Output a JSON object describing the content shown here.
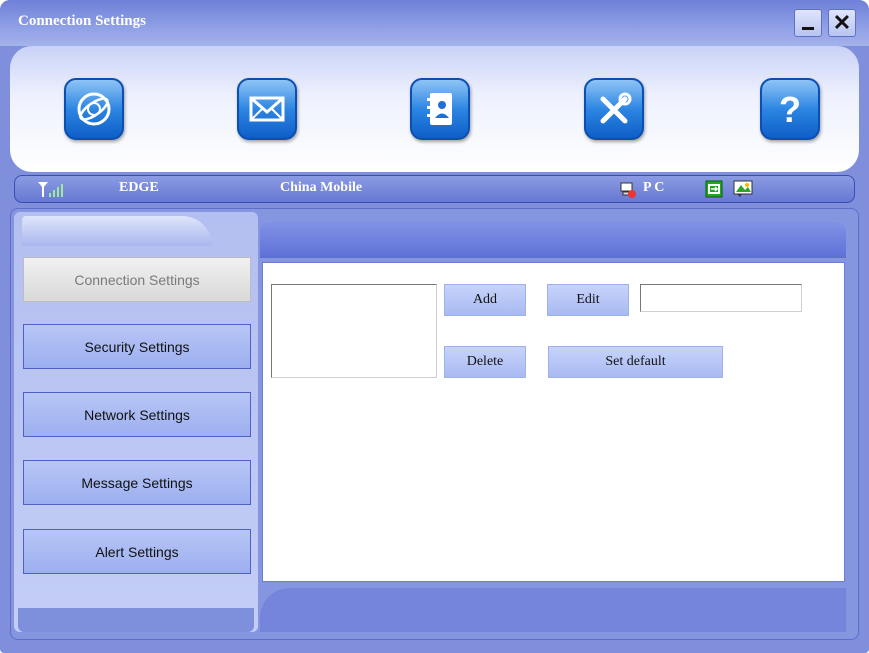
{
  "window": {
    "title": "Connection Settings"
  },
  "toolbar": {
    "buttons": [
      {
        "name": "internet-connect",
        "icon": "globe-icon"
      },
      {
        "name": "messages",
        "icon": "envelope-icon"
      },
      {
        "name": "phonebook",
        "icon": "contacts-book-icon"
      },
      {
        "name": "settings",
        "icon": "tools-icon"
      },
      {
        "name": "help",
        "icon": "question-mark-icon"
      }
    ]
  },
  "status": {
    "network_type": "EDGE",
    "operator": "China Mobile",
    "device_label": "P C"
  },
  "sidebar": {
    "items": [
      {
        "label": "Connection Settings",
        "active": true
      },
      {
        "label": "Security Settings",
        "active": false
      },
      {
        "label": "Network Settings",
        "active": false
      },
      {
        "label": "Message Settings",
        "active": false
      },
      {
        "label": "Alert Settings",
        "active": false
      }
    ]
  },
  "panel": {
    "add_label": "Add",
    "edit_label": "Edit",
    "delete_label": "Delete",
    "set_default_label": "Set default",
    "profile_name_value": ""
  },
  "colors": {
    "accent": "#6f80d8",
    "icon_button": "#2d86e2"
  }
}
